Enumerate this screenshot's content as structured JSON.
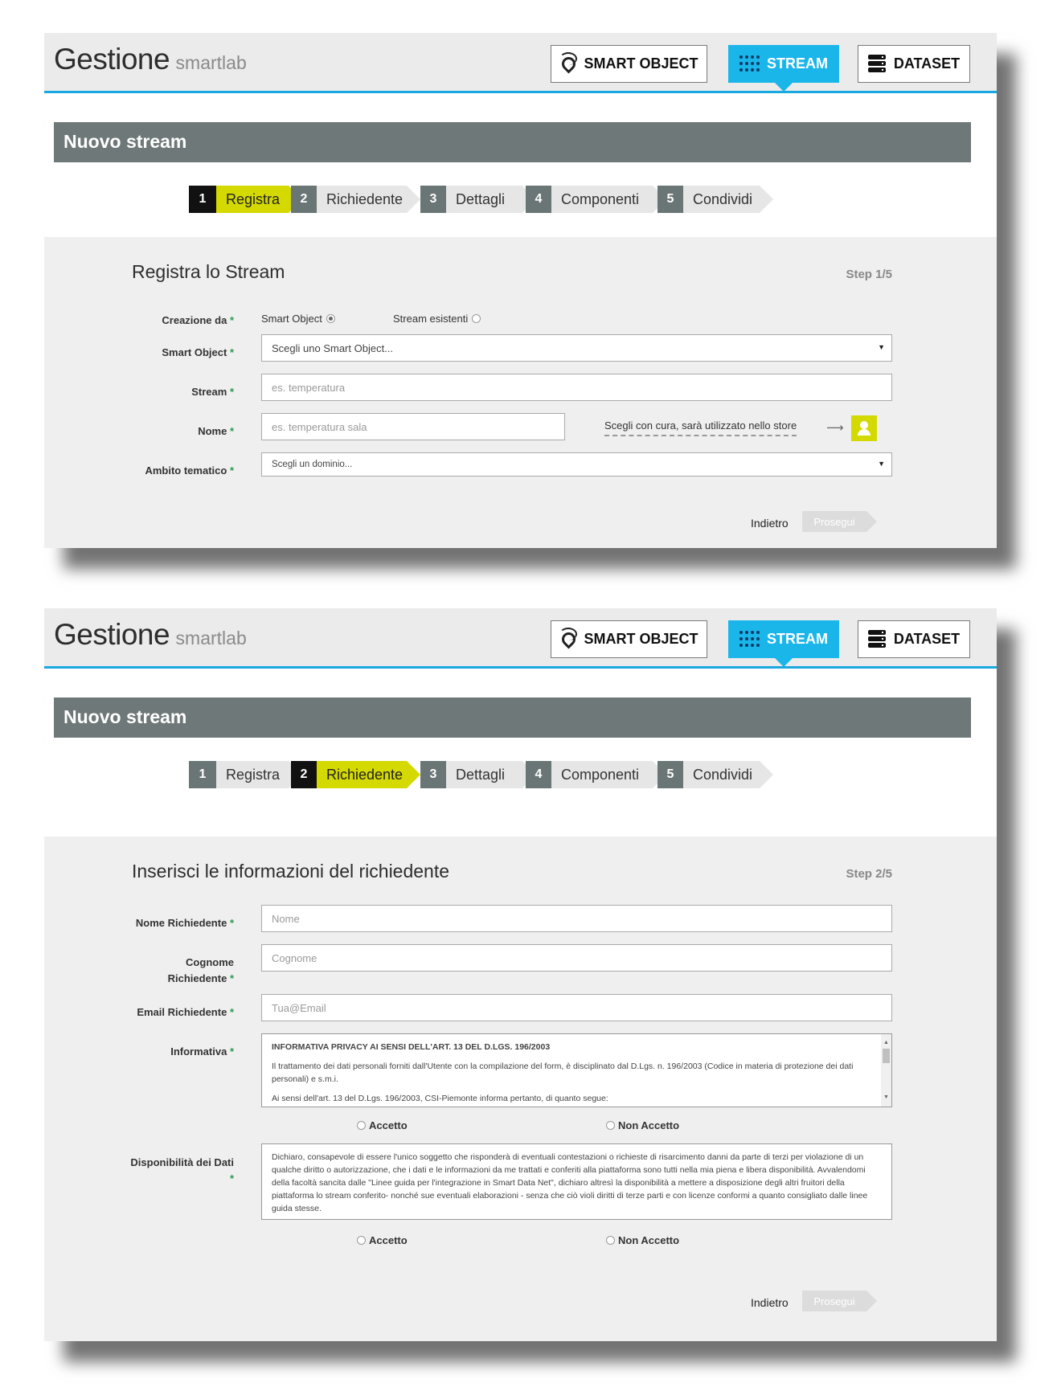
{
  "header": {
    "brand_main": "Gestione",
    "brand_sub": "smartlab",
    "nav": {
      "smart_object": "SMART OBJECT",
      "stream": "STREAM",
      "dataset": "DATASET"
    }
  },
  "page_title": "Nuovo stream",
  "steps": [
    {
      "num": "1",
      "label": "Registra"
    },
    {
      "num": "2",
      "label": "Richiedente"
    },
    {
      "num": "3",
      "label": "Dettagli"
    },
    {
      "num": "4",
      "label": "Componenti"
    },
    {
      "num": "5",
      "label": "Condividi"
    }
  ],
  "screen1": {
    "active_step": 1,
    "heading": "Registra lo Stream",
    "step_indicator": "Step 1/5",
    "creazione_label": "Creazione da",
    "radio_smart_object": "Smart Object",
    "radio_stream_esistenti": "Stream esistenti",
    "smart_object_label": "Smart Object",
    "smart_object_select": "Scegli uno Smart Object...",
    "stream_label": "Stream",
    "stream_placeholder": "es. temperatura",
    "nome_label": "Nome",
    "nome_placeholder": "es. temperatura sala",
    "nome_hint": "Scegli con cura, sarà utilizzato nello store",
    "ambito_label": "Ambito tematico",
    "ambito_select": "Scegli un dominio...",
    "back": "Indietro",
    "next": "Prosegui"
  },
  "screen2": {
    "active_step": 2,
    "heading": "Inserisci le informazioni del richiedente",
    "step_indicator": "Step 2/5",
    "nome_label": "Nome Richiedente",
    "nome_placeholder": "Nome",
    "cognome_label_1": "Cognome",
    "cognome_label_2": "Richiedente",
    "cognome_placeholder": "Cognome",
    "email_label": "Email Richiedente",
    "email_placeholder": "Tua@Email",
    "informativa_label": "Informativa",
    "informativa_title": "INFORMATIVA PRIVACY AI SENSI DELL'ART. 13 DEL D.LGS. 196/2003",
    "informativa_p1": "Il trattamento dei dati personali forniti dall'Utente con la compilazione del form, è disciplinato dal D.Lgs. n. 196/2003 (Codice in materia di protezione dei dati personali) e s.m.i.",
    "informativa_p2": "Ai sensi dell'art. 13 del D.Lgs. 196/2003, CSI-Piemonte informa pertanto, di quanto segue:",
    "accetto": "Accetto",
    "non_accetto": "Non Accetto",
    "disponibilita_label": "Disponibilità dei Dati",
    "disponibilita_text": "Dichiaro, consapevole di essere l'unico soggetto che risponderà di eventuali contestazioni o richieste di risarcimento danni da parte di terzi per violazione di un qualche diritto o autorizzazione, che i dati e le informazioni da me trattati e conferiti alla piattaforma sono tutti nella mia piena e libera disponibilità. Avvalendomi della facoltà sancita dalle \"Linee guida per l'integrazione in Smart Data Net\", dichiaro altresì la disponibilità a mettere a disposizione degli altri fruitori della piattaforma lo stream conferito- nonché sue eventuali elaborazioni - senza che ciò violi diritti di terze parti e con licenze conformi a quanto consigliato dalle linee guida stesse.",
    "back": "Indietro",
    "next": "Prosegui"
  },
  "required_mark": "*",
  "colors": {
    "accent_blue": "#1ab6ea",
    "step_active": "#d4d900",
    "title_bar": "#6f7878"
  }
}
